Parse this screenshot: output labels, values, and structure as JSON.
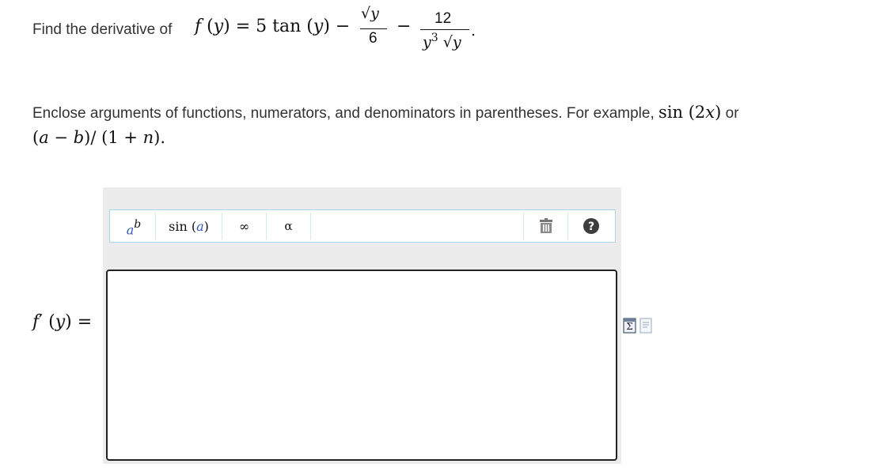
{
  "question": {
    "prefix": "Find the derivative of",
    "lhs": "f (y) = 5 tan (y) −",
    "frac1_num": "√y",
    "frac1_den": "6",
    "minus": "−",
    "frac2_num": "12",
    "frac2_den": "y³ √y",
    "period": "."
  },
  "instructions": {
    "text": "Enclose arguments of functions, numerators, and denominators in parentheses. For example,",
    "example1": "sin (2x)",
    "or": "or",
    "example2": "(a − b)/ (1 + n)."
  },
  "toolbar": {
    "power_label": "aᵇ",
    "sin_label": "sin (a)",
    "infinity_label": "∞",
    "alpha_label": "α",
    "delete_tooltip": "delete",
    "help_label": "?"
  },
  "answer": {
    "label": "f′ (y) =",
    "value": ""
  },
  "colors": {
    "panel_bg": "#ececec",
    "toolbar_border": "#a9d6e5",
    "help_bg": "#3d3d3d",
    "power_a": "#3355bb"
  }
}
